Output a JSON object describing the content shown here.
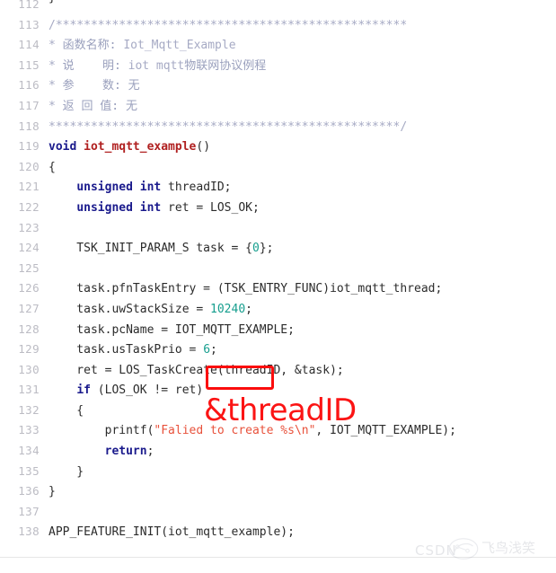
{
  "viewer": {
    "name": "code-viewer",
    "language": "c",
    "first_visible_line": 112,
    "last_visible_line": 138,
    "clipped_top_glyph": "}"
  },
  "colors": {
    "background": "#ffffff",
    "line_number": "#bcbcc4",
    "comment": "#a6aac4",
    "keyword": "#1a1a8c",
    "function_name": "#b02020",
    "number_literal": "#169e8e",
    "string_literal": "#e8513b",
    "plain_text": "#2b2b2b",
    "annotation_red": "#fb1414",
    "divider": "#e6e6e6"
  },
  "lines": [
    {
      "num": "112",
      "tokens": []
    },
    {
      "num": "113",
      "tokens": [
        {
          "cls": "t-comment",
          "text": "/**************************************************"
        }
      ]
    },
    {
      "num": "114",
      "tokens": [
        {
          "cls": "t-comment",
          "text": "* "
        },
        {
          "cls": "t-comment-cn",
          "text": "函数名称: "
        },
        {
          "cls": "t-comment",
          "text": "Iot_Mqtt_Example"
        }
      ]
    },
    {
      "num": "115",
      "tokens": [
        {
          "cls": "t-comment",
          "text": "* "
        },
        {
          "cls": "t-comment-cn",
          "text": "说    明: "
        },
        {
          "cls": "t-comment",
          "text": "iot mqtt"
        },
        {
          "cls": "t-comment-cn",
          "text": "物联网协议例程"
        }
      ]
    },
    {
      "num": "116",
      "tokens": [
        {
          "cls": "t-comment",
          "text": "* "
        },
        {
          "cls": "t-comment-cn",
          "text": "参    数: 无"
        }
      ]
    },
    {
      "num": "117",
      "tokens": [
        {
          "cls": "t-comment",
          "text": "* "
        },
        {
          "cls": "t-comment-cn",
          "text": "返 回 值: 无"
        }
      ]
    },
    {
      "num": "118",
      "tokens": [
        {
          "cls": "t-comment",
          "text": "**************************************************/"
        }
      ]
    },
    {
      "num": "119",
      "tokens": [
        {
          "cls": "t-key",
          "text": "void"
        },
        {
          "cls": "t-plain",
          "text": " "
        },
        {
          "cls": "t-fn",
          "text": "iot_mqtt_example"
        },
        {
          "cls": "t-punct",
          "text": "()"
        }
      ]
    },
    {
      "num": "120",
      "tokens": [
        {
          "cls": "t-punct",
          "text": "{"
        }
      ]
    },
    {
      "num": "121",
      "tokens": [
        {
          "cls": "t-plain",
          "text": "    "
        },
        {
          "cls": "t-key",
          "text": "unsigned int"
        },
        {
          "cls": "t-plain",
          "text": " threadID;"
        }
      ]
    },
    {
      "num": "122",
      "tokens": [
        {
          "cls": "t-plain",
          "text": "    "
        },
        {
          "cls": "t-key",
          "text": "unsigned int"
        },
        {
          "cls": "t-plain",
          "text": " ret = LOS_OK;"
        }
      ]
    },
    {
      "num": "123",
      "tokens": []
    },
    {
      "num": "124",
      "tokens": [
        {
          "cls": "t-plain",
          "text": "    TSK_INIT_PARAM_S task = {"
        },
        {
          "cls": "t-num",
          "text": "0"
        },
        {
          "cls": "t-plain",
          "text": "};"
        }
      ]
    },
    {
      "num": "125",
      "tokens": []
    },
    {
      "num": "126",
      "tokens": [
        {
          "cls": "t-plain",
          "text": "    task.pfnTaskEntry = (TSK_ENTRY_FUNC)iot_mqtt_thread;"
        }
      ]
    },
    {
      "num": "127",
      "tokens": [
        {
          "cls": "t-plain",
          "text": "    task.uwStackSize = "
        },
        {
          "cls": "t-num",
          "text": "10240"
        },
        {
          "cls": "t-plain",
          "text": ";"
        }
      ]
    },
    {
      "num": "128",
      "tokens": [
        {
          "cls": "t-plain",
          "text": "    task.pcName = IOT_MQTT_EXAMPLE;"
        }
      ]
    },
    {
      "num": "129",
      "tokens": [
        {
          "cls": "t-plain",
          "text": "    task.usTaskPrio = "
        },
        {
          "cls": "t-num",
          "text": "6"
        },
        {
          "cls": "t-plain",
          "text": ";"
        }
      ]
    },
    {
      "num": "130",
      "tokens": [
        {
          "cls": "t-plain",
          "text": "    ret = LOS_TaskCreate(threadID, &task);"
        }
      ]
    },
    {
      "num": "131",
      "tokens": [
        {
          "cls": "t-plain",
          "text": "    "
        },
        {
          "cls": "t-key",
          "text": "if"
        },
        {
          "cls": "t-plain",
          "text": " (LOS_OK != ret)"
        }
      ]
    },
    {
      "num": "132",
      "tokens": [
        {
          "cls": "t-plain",
          "text": "    {"
        }
      ]
    },
    {
      "num": "133",
      "tokens": [
        {
          "cls": "t-plain",
          "text": "        printf("
        },
        {
          "cls": "t-str",
          "text": "\"Falied to create %s\\n\""
        },
        {
          "cls": "t-plain",
          "text": ", IOT_MQTT_EXAMPLE);"
        }
      ]
    },
    {
      "num": "134",
      "tokens": [
        {
          "cls": "t-plain",
          "text": "        "
        },
        {
          "cls": "t-key",
          "text": "return"
        },
        {
          "cls": "t-plain",
          "text": ";"
        }
      ]
    },
    {
      "num": "135",
      "tokens": [
        {
          "cls": "t-plain",
          "text": "    }"
        }
      ]
    },
    {
      "num": "136",
      "tokens": [
        {
          "cls": "t-plain",
          "text": "}"
        }
      ]
    },
    {
      "num": "137",
      "tokens": []
    },
    {
      "num": "138",
      "tokens": [
        {
          "cls": "t-plain",
          "text": "APP_FEATURE_INIT(iot_mqtt_example);"
        }
      ]
    }
  ],
  "annotation": {
    "highlight_target": "(threadID",
    "highlight_line": "130",
    "correction_text": "&threadID",
    "color": "#fb1414"
  },
  "watermark": {
    "brand": "CSDN",
    "author": "飞鸟浅笑",
    "logo_icon": "csdn-logo-icon"
  }
}
